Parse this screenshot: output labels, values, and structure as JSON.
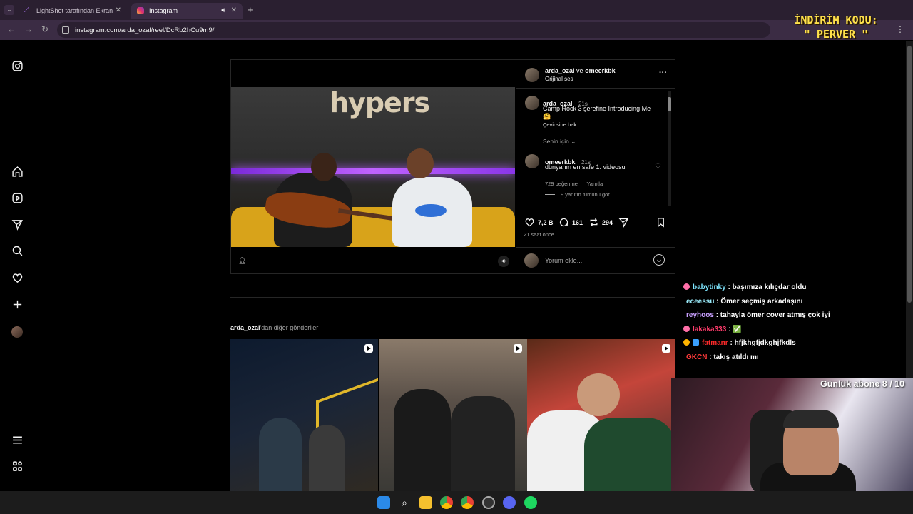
{
  "browser": {
    "tabs": [
      {
        "title": "LightShot tarafından Ekran Görü",
        "active": false
      },
      {
        "title": "Instagram",
        "active": true
      }
    ],
    "new_tab": "+",
    "url": "instagram.com/arda_ozal/reel/DcRb2hCu9m9/"
  },
  "sidebar": {
    "items": [
      "instagram-logo",
      "home",
      "reels",
      "messages",
      "search",
      "notifications",
      "create",
      "profile",
      "more",
      "also-from-meta"
    ]
  },
  "post": {
    "video_wall_text": "hypers",
    "header": {
      "user1": "arda_ozal",
      "joiner": "ve",
      "user2": "omeerkbk",
      "audio": "Orijinal ses",
      "more": "···"
    },
    "caption": {
      "user": "arda_ozal",
      "time": "21s",
      "text": "Camp Rock 3 şerefine Introducing Me",
      "emoji": "🤗",
      "translate": "Çevirisine bak"
    },
    "filter_label": "Senin için",
    "comment": {
      "user": "omeerkbk",
      "time": "21s",
      "text": "dünyanın en safe 1. videosu",
      "likes": "729 beğenme",
      "reply": "Yanıtla",
      "view_replies": "9 yanıtın tümünü gör"
    },
    "actions": {
      "likes": "7,2 B",
      "comments": "161",
      "reposts": "294"
    },
    "posted_ago": "21 saat önce",
    "comment_placeholder": "Yorum ekle..."
  },
  "more_posts": {
    "user": "arda_ozal",
    "suffix": "'dan diğer gönderiler"
  },
  "overlay": {
    "promo_line1": "İNDİRİM KODU:",
    "promo_line2": "\" PERVER \"",
    "sub_goal": "Günlük abone 8 / 10",
    "chat": [
      {
        "user": "babytinky",
        "text": ": başımıza kılıçdar oldu",
        "color": "#7fe6ff",
        "badge": "#ff6fa8"
      },
      {
        "user": "eceessu",
        "text": ": Ömer seçmiş arkadaşını",
        "color": "#9ef0ff",
        "badge": ""
      },
      {
        "user": "reyhoos",
        "text": ": tahayla ömer cover atmış çok iyi",
        "color": "#c9a0ff",
        "badge": ""
      },
      {
        "user": "lakaka333",
        "text": ": ✅",
        "color": "#ff3b6b",
        "badge": "#ff6fa8"
      },
      {
        "user": "fatmanr",
        "text": ": hfjkhgfjdkghjfkdls",
        "color": "#ff2a2a",
        "badge": "#ffb400"
      },
      {
        "user": "GKCN",
        "text": ": takış atıldı mı",
        "color": "#ff3a3a",
        "badge": ""
      }
    ]
  },
  "colors": {
    "background": "#000000",
    "border": "#262626",
    "browser_frame": "#3b2c44",
    "neon": "#b45cff"
  }
}
